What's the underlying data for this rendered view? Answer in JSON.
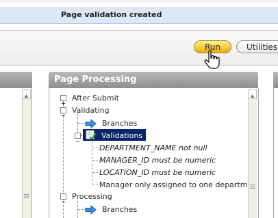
{
  "notification": {
    "message": "Page validation created"
  },
  "toolbar": {
    "run_label": "Run",
    "utilities_label": "Utilities"
  },
  "panel": {
    "title": "Page Processing"
  },
  "tree": {
    "after_submit": "After Submit",
    "validating": "Validating",
    "branches_1": "Branches",
    "validations": "Validations",
    "validation_items": [
      "DEPARTMENT_NAME not null",
      "MANAGER_ID must be numeric",
      "LOCATION_ID must be numeric",
      "Manager only assigned to one departme"
    ],
    "processing": "Processing",
    "branches_2": "Branches"
  },
  "icons": {
    "branch_arrow": "arrow-right-icon",
    "validations": "validation-check-icon",
    "cursor": "hand-pointer-icon"
  },
  "colors": {
    "notification_bg": "#dce8f7",
    "run_button": "#f7cc3c",
    "selection": "#0a246a",
    "panel_header": "#9e9e9e",
    "branch_arrow": "#3b8fd8"
  }
}
